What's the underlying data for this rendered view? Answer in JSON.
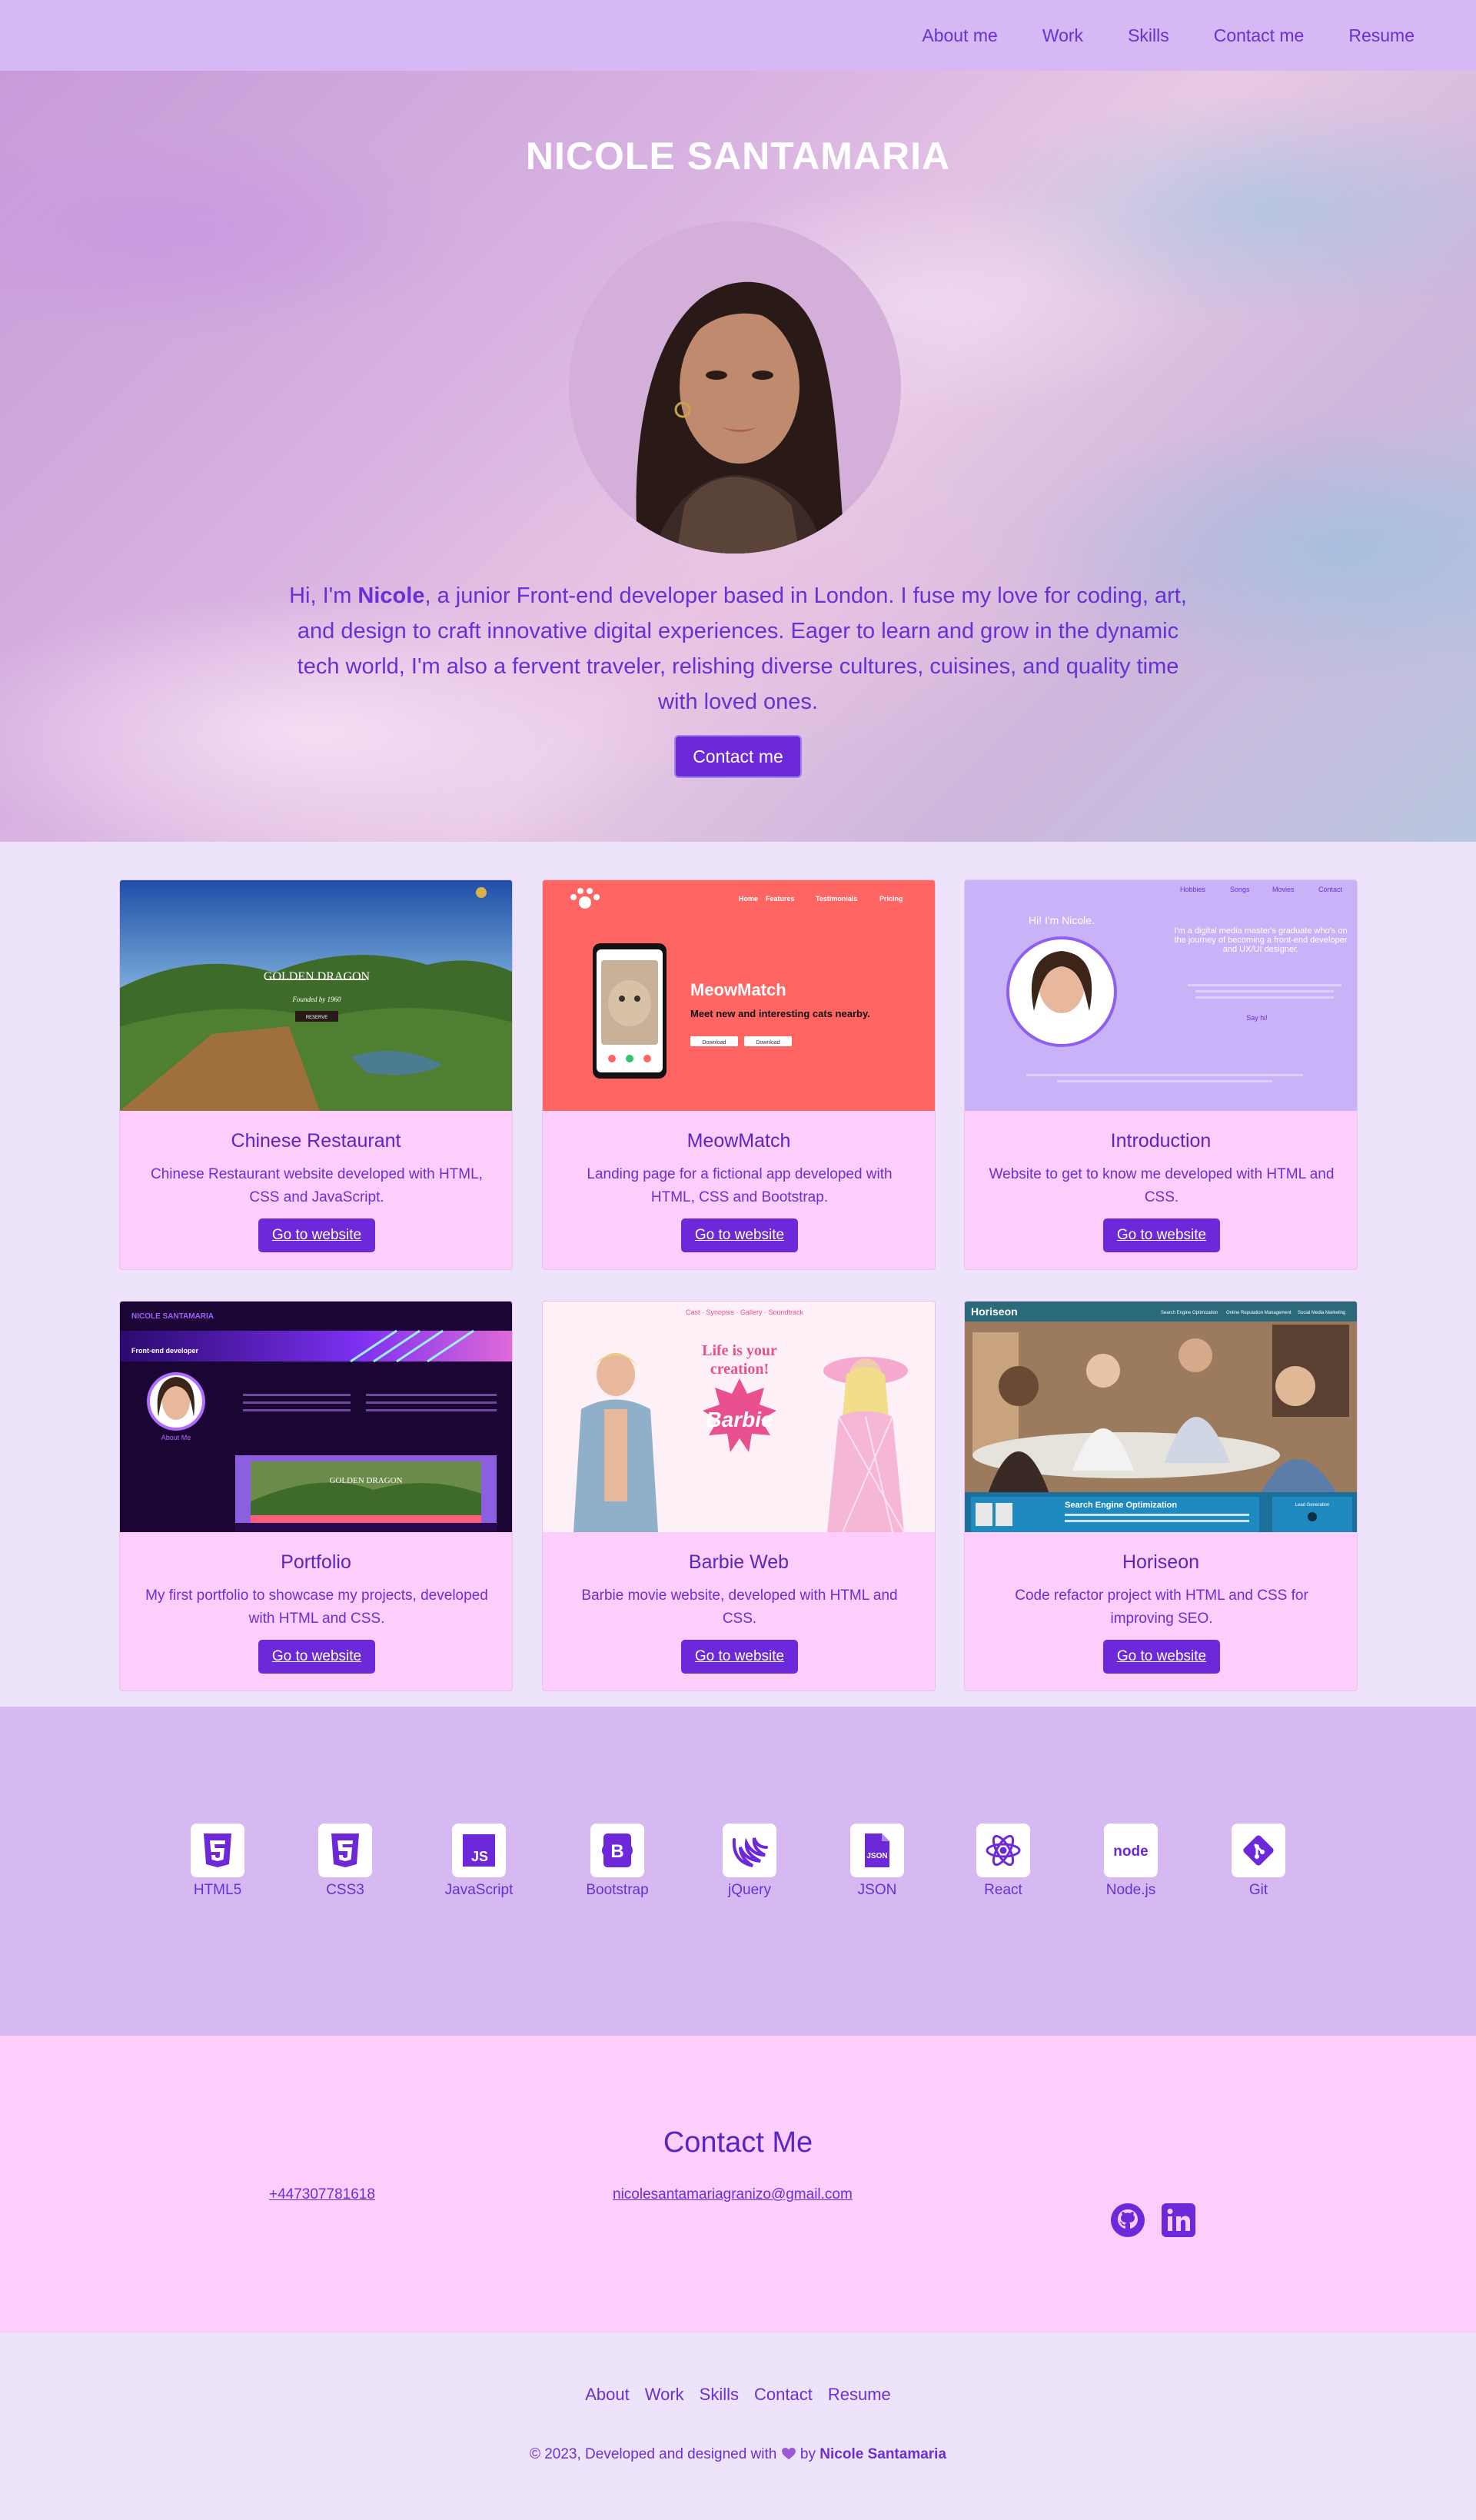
{
  "nav": {
    "items": [
      {
        "label": "About me"
      },
      {
        "label": "Work"
      },
      {
        "label": "Skills"
      },
      {
        "label": "Contact me"
      },
      {
        "label": "Resume"
      }
    ]
  },
  "hero": {
    "title": "NICOLE SANTAMARIA",
    "intro_prefix": "Hi, I'm ",
    "intro_name": "Nicole",
    "intro_text": ", a junior Front-end developer based in London. I fuse my love for coding, art, and design to craft innovative digital experiences. Eager to learn and grow in the dynamic tech world, I'm also a fervent traveler, relishing diverse cultures, cuisines, and quality time with loved ones.",
    "button": "Contact me"
  },
  "projects": [
    {
      "title": "Chinese Restaurant",
      "description": "Chinese Restaurant website developed with HTML, CSS and JavaScript.",
      "button": "Go to website",
      "thumb": {
        "heading": "GOLDEN DRAGON",
        "sub": "Founded by 1960",
        "btn": "RESERVE"
      }
    },
    {
      "title": "MeowMatch",
      "description": "Landing page for a fictional app developed with HTML, CSS and Bootstrap.",
      "button": "Go to website",
      "thumb": {
        "heading": "MeowMatch",
        "sub": "Meet new and interesting cats nearby.",
        "nav": [
          "Home",
          "Features",
          "Testimonials",
          "Pricing"
        ],
        "btn1": "Download",
        "btn2": "Download"
      }
    },
    {
      "title": "Introduction",
      "description": "Website to get to know me developed with HTML and CSS.",
      "button": "Go to website",
      "thumb": {
        "greeting": "Hi! I'm Nicole.",
        "nav": [
          "Hobbies",
          "Songs",
          "Movies",
          "Contact"
        ],
        "tagline": "I'm a digital media master's graduate who's on the journey of becoming a front-end developer and UX/UI designer.",
        "link": "Say hi!"
      }
    },
    {
      "title": "Portfolio",
      "description": "My first portfolio to showcase my projects, developed with HTML and CSS.",
      "button": "Go to website",
      "thumb": {
        "brand": "NICOLE SANTAMARIA",
        "banner": "Front-end developer",
        "about": "About Me",
        "project": "GOLDEN DRAGON"
      }
    },
    {
      "title": "Barbie Web",
      "description": "Barbie movie website, developed with HTML and CSS.",
      "button": "Go to website",
      "thumb": {
        "nav": "Cast · Synopsis · Gallery · Soundtrack",
        "tagline1": "Life is your",
        "tagline2": "creation!",
        "logo": "Barbie"
      }
    },
    {
      "title": "Horiseon",
      "description": "Code refactor project with HTML and CSS for improving SEO.",
      "button": "Go to website",
      "thumb": {
        "brand": "Horiseon",
        "nav": [
          "Search Engine Optimization",
          "Online Reputation Management",
          "Social Media Marketing"
        ],
        "section": "Search Engine Optimization",
        "side": "Lead Generation"
      }
    }
  ],
  "skills": [
    {
      "label": "HTML5",
      "icon": "html5-icon"
    },
    {
      "label": "CSS3",
      "icon": "css3-icon"
    },
    {
      "label": "JavaScript",
      "icon": "javascript-icon"
    },
    {
      "label": "Bootstrap",
      "icon": "bootstrap-icon"
    },
    {
      "label": "jQuery",
      "icon": "jquery-icon"
    },
    {
      "label": "JSON",
      "icon": "json-icon"
    },
    {
      "label": "React",
      "icon": "react-icon"
    },
    {
      "label": "Node.js",
      "icon": "nodejs-icon"
    },
    {
      "label": "Git",
      "icon": "git-icon"
    }
  ],
  "contact": {
    "title": "Contact Me",
    "phone": "+447307781618",
    "email": "nicolesantamariagranizo@gmail.com",
    "social": [
      "github-icon",
      "linkedin-icon"
    ]
  },
  "footer": {
    "links": [
      {
        "label": "About"
      },
      {
        "label": "Work"
      },
      {
        "label": "Skills"
      },
      {
        "label": "Contact"
      },
      {
        "label": "Resume"
      }
    ],
    "copy_prefix": "© 2023, Developed and designed with",
    "copy_by": "by",
    "copy_name": "Nicole Santamaria"
  },
  "colors": {
    "accent": "#6d28d9",
    "nav_bg": "#d6b9f4",
    "card_bg": "#fdcdfc",
    "section_bg": "#ede4fc",
    "skills_bg": "#d6b9f0"
  }
}
